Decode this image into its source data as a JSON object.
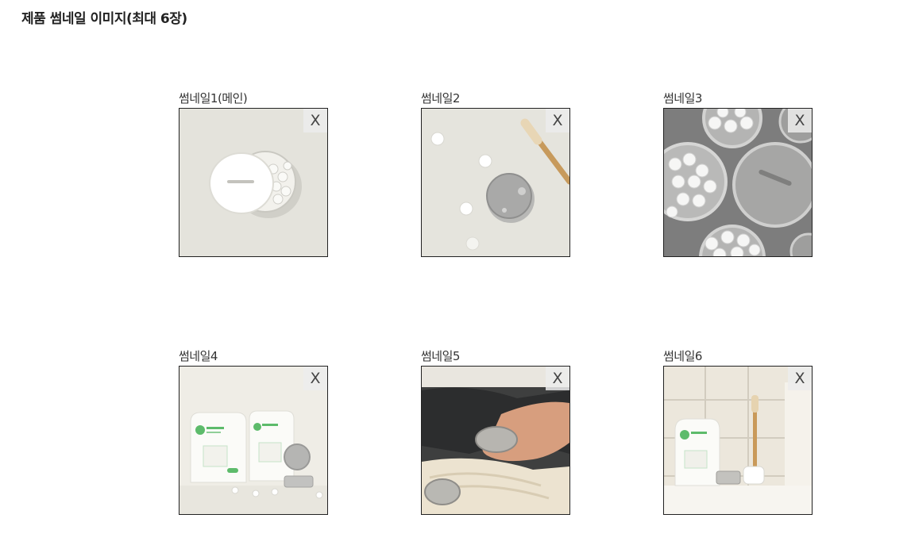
{
  "section_title": "제품 썸네일 이미지(최대 6장)",
  "remove_label": "X",
  "thumbnails": [
    {
      "label": "썸네일1(메인)",
      "image": "white-tin-with-tablets"
    },
    {
      "label": "썸네일2",
      "image": "silver-tin-with-toothbrush"
    },
    {
      "label": "썸네일3",
      "image": "open-tins-with-tablets"
    },
    {
      "label": "썸네일4",
      "image": "refill-pouches-and-tin"
    },
    {
      "label": "썸네일5",
      "image": "hand-holding-tin"
    },
    {
      "label": "썸네일6",
      "image": "bathroom-shelf-with-pouch"
    }
  ]
}
